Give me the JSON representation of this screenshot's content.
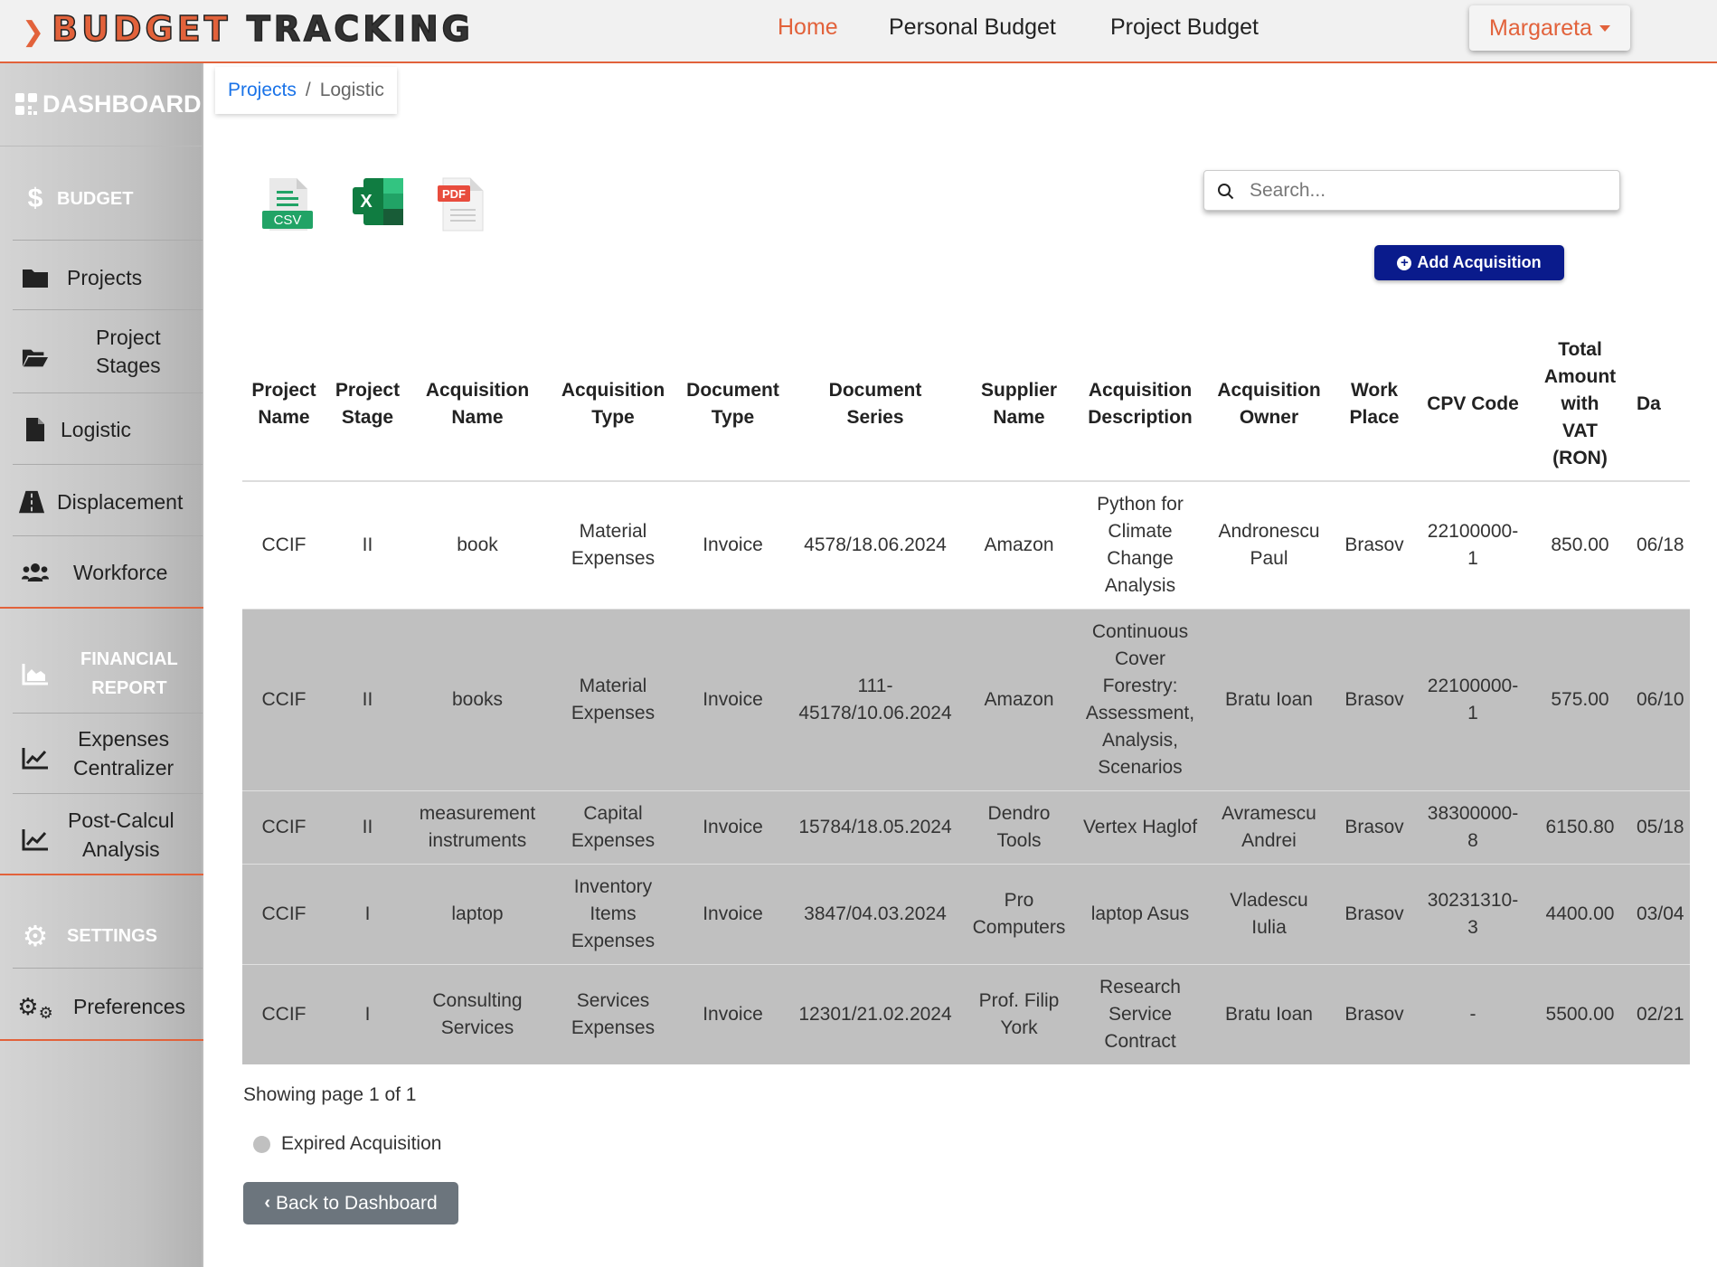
{
  "app": {
    "logo_part1": "BUDGET",
    "logo_part2": "TRACKING",
    "accent_color": "#e2623b"
  },
  "nav": {
    "home": "Home",
    "personal_budget": "Personal Budget",
    "project_budget": "Project Budget",
    "user": "Margareta"
  },
  "sidebar": {
    "dashboard": "DASHBOARD",
    "budget_header": "BUDGET",
    "projects": "Projects",
    "project_stages_1": "Project",
    "project_stages_2": "Stages",
    "logistic": "Logistic",
    "displacement": "Displacement",
    "workforce": "Workforce",
    "financial_header_1": "FINANCIAL",
    "financial_header_2": "REPORT",
    "expenses_1": "Expenses",
    "expenses_2": "Centralizer",
    "postcalcul_1": "Post-Calcul",
    "postcalcul_2": "Analysis",
    "settings_header": "SETTINGS",
    "preferences": "Preferences"
  },
  "breadcrumb": {
    "root": "Projects",
    "separator": "/",
    "current": "Logistic"
  },
  "exports": {
    "csv_label": "CSV",
    "excel_label": "X",
    "pdf_label": "PDF"
  },
  "search": {
    "placeholder": "Search..."
  },
  "actions": {
    "add": "Add Acquisition",
    "back": "Back to Dashboard"
  },
  "table": {
    "headers": [
      [
        "Project",
        "Name"
      ],
      [
        "Project",
        "Stage"
      ],
      [
        "Acquisition",
        "Name"
      ],
      [
        "Acquisition",
        "Type"
      ],
      [
        "Document",
        "Type"
      ],
      [
        "Document",
        "Series"
      ],
      [
        "Supplier",
        "Name"
      ],
      [
        "Acquisition",
        "Description"
      ],
      [
        "Acquisition",
        "Owner"
      ],
      [
        "Work",
        "Place"
      ],
      [
        "CPV Code"
      ],
      [
        "Total",
        "Amount",
        "with",
        "VAT",
        "(RON)"
      ],
      [
        "Da"
      ]
    ],
    "rows": [
      [
        "CCIF",
        "II",
        "book",
        "Material Expenses",
        "Invoice",
        "4578/18.06.2024",
        "Amazon",
        "Python for Climate Change Analysis",
        "Andronescu Paul",
        "Brasov",
        "22100000-1",
        "850.00",
        "06/18"
      ],
      [
        "CCIF",
        "II",
        "books",
        "Material Expenses",
        "Invoice",
        "111-45178/10.06.2024",
        "Amazon",
        "Continuous Cover Forestry: Assessment, Analysis, Scenarios",
        "Bratu Ioan",
        "Brasov",
        "22100000-1",
        "575.00",
        "06/10"
      ],
      [
        "CCIF",
        "II",
        "measurement instruments",
        "Capital Expenses",
        "Invoice",
        "15784/18.05.2024",
        "Dendro Tools",
        "Vertex Haglof",
        "Avramescu Andrei",
        "Brasov",
        "38300000-8",
        "6150.80",
        "05/18"
      ],
      [
        "CCIF",
        "I",
        "laptop",
        "Inventory Items Expenses",
        "Invoice",
        "3847/04.03.2024",
        "Pro Computers",
        "laptop Asus",
        "Vladescu Iulia",
        "Brasov",
        "30231310-3",
        "4400.00",
        "03/04"
      ],
      [
        "CCIF",
        "I",
        "Consulting Services",
        "Services Expenses",
        "Invoice",
        "12301/21.02.2024",
        "Prof. Filip York",
        "Research Service Contract",
        "Bratu Ioan",
        "Brasov",
        "-",
        "5500.00",
        "02/21"
      ]
    ]
  },
  "footer": {
    "page_info": "Showing page 1 of 1",
    "legend": "Expired Acquisition"
  }
}
